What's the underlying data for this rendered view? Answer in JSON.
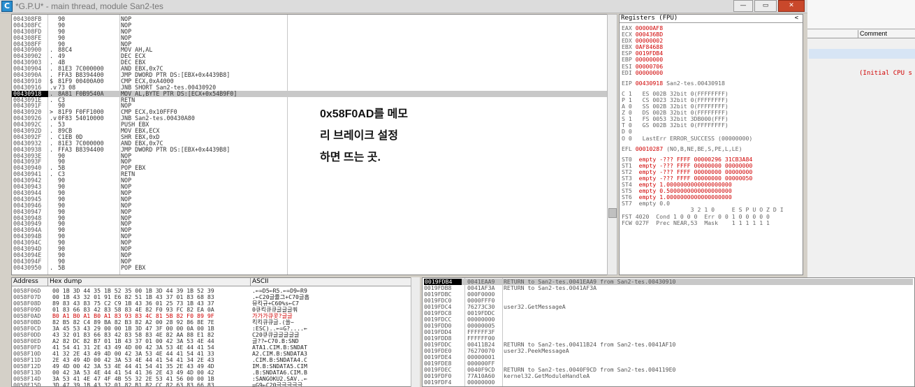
{
  "window": {
    "title": "*G.P.U* - main thread, module San2-tes",
    "icon_letter": "C",
    "min_label": "—",
    "max_label": "▭",
    "close_label": "✕"
  },
  "background_window": {
    "comment_header": "Comment",
    "initial_text": "(Initial CPU s"
  },
  "cpu": {
    "rows": [
      {
        "addr": "004308FB",
        "mark": "",
        "hex": "90",
        "dis": "NOP"
      },
      {
        "addr": "004308FC",
        "mark": "",
        "hex": "90",
        "dis": "NOP"
      },
      {
        "addr": "004308FD",
        "mark": "",
        "hex": "90",
        "dis": "NOP"
      },
      {
        "addr": "004308FE",
        "mark": "",
        "hex": "90",
        "dis": "NOP"
      },
      {
        "addr": "004308FF",
        "mark": "",
        "hex": "90",
        "dis": "NOP"
      },
      {
        "addr": "00430900",
        "mark": ".",
        "hex": "88C4",
        "dis": "MOV AH,AL"
      },
      {
        "addr": "00430902",
        "mark": ".",
        "hex": "49",
        "dis": "DEC ECX"
      },
      {
        "addr": "00430903",
        "mark": ".",
        "hex": "4B",
        "dis": "DEC EBX"
      },
      {
        "addr": "00430904",
        "mark": ".",
        "hex": "81E3 7C000000",
        "dis": "AND EBX,0x7C"
      },
      {
        "addr": "0043090A",
        "mark": ".",
        "hex": "FFA3 B8394400",
        "dis": "JMP DWORD PTR DS:[EBX+0x4439B8]"
      },
      {
        "addr": "00430910",
        "mark": "$",
        "hex": "81F9 00400A00",
        "dis": "CMP ECX,0xA4000"
      },
      {
        "addr": "00430916",
        "mark": ".v",
        "hex": "73 08",
        "dis": "JNB SHORT San2-tes.00430920"
      },
      {
        "addr": "00430918",
        "mark": ".",
        "hex": "8A81 F0B9540A",
        "dis": "MOV AL,BYTE PTR DS:[ECX+0x54B9F0]"
      },
      {
        "addr": "0043091E",
        "mark": ".",
        "hex": "C3",
        "dis": "RETN"
      },
      {
        "addr": "0043091F",
        "mark": "",
        "hex": "90",
        "dis": "NOP"
      },
      {
        "addr": "00430920",
        "mark": ">",
        "hex": "81F9 F0FF1000",
        "dis": "CMP ECX,0x10FFF0"
      },
      {
        "addr": "00430926",
        "mark": ".v",
        "hex": "0F83 54010000",
        "dis": "JNB San2-tes.00430A80"
      },
      {
        "addr": "0043092C",
        "mark": ".",
        "hex": "53",
        "dis": "PUSH EBX"
      },
      {
        "addr": "0043092D",
        "mark": ".",
        "hex": "89CB",
        "dis": "MOV EBX,ECX"
      },
      {
        "addr": "0043092F",
        "mark": ".",
        "hex": "C1EB 0D",
        "dis": "SHR EBX,0xD"
      },
      {
        "addr": "00430932",
        "mark": ".",
        "hex": "81E3 7C000000",
        "dis": "AND EBX,0x7C"
      },
      {
        "addr": "00430938",
        "mark": ".",
        "hex": "FFA3 B8394400",
        "dis": "JMP DWORD PTR DS:[EBX+0x4439B8]"
      },
      {
        "addr": "0043093E",
        "mark": "",
        "hex": "90",
        "dis": "NOP"
      },
      {
        "addr": "0043093F",
        "mark": "",
        "hex": "90",
        "dis": "NOP"
      },
      {
        "addr": "00430940",
        "mark": ".",
        "hex": "5B",
        "dis": "POP EBX"
      },
      {
        "addr": "00430941",
        "mark": ".",
        "hex": "C3",
        "dis": "RETN"
      },
      {
        "addr": "00430942",
        "mark": "",
        "hex": "90",
        "dis": "NOP"
      },
      {
        "addr": "00430943",
        "mark": "",
        "hex": "90",
        "dis": "NOP"
      },
      {
        "addr": "00430944",
        "mark": "",
        "hex": "90",
        "dis": "NOP"
      },
      {
        "addr": "00430945",
        "mark": "",
        "hex": "90",
        "dis": "NOP"
      },
      {
        "addr": "00430946",
        "mark": "",
        "hex": "90",
        "dis": "NOP"
      },
      {
        "addr": "00430947",
        "mark": "",
        "hex": "90",
        "dis": "NOP"
      },
      {
        "addr": "00430948",
        "mark": "",
        "hex": "90",
        "dis": "NOP"
      },
      {
        "addr": "00430949",
        "mark": "",
        "hex": "90",
        "dis": "NOP"
      },
      {
        "addr": "0043094A",
        "mark": "",
        "hex": "90",
        "dis": "NOP"
      },
      {
        "addr": "0043094B",
        "mark": "",
        "hex": "90",
        "dis": "NOP"
      },
      {
        "addr": "0043094C",
        "mark": "",
        "hex": "90",
        "dis": "NOP"
      },
      {
        "addr": "0043094D",
        "mark": "",
        "hex": "90",
        "dis": "NOP"
      },
      {
        "addr": "0043094E",
        "mark": "",
        "hex": "90",
        "dis": "NOP"
      },
      {
        "addr": "0043094F",
        "mark": "",
        "hex": "90",
        "dis": "NOP"
      },
      {
        "addr": "00430950",
        "mark": ".",
        "hex": "5B",
        "dis": "POP EBX"
      }
    ],
    "annotation": [
      "0x58F0AD를 메모",
      "리 브레이크 설정",
      "하면 뜨는 곳."
    ]
  },
  "registers": {
    "header": "Registers (FPU)",
    "chevron": "<",
    "lines": [
      {
        "label": "EAX",
        "value": "00000AF8",
        "extra": "",
        "red": true
      },
      {
        "label": "ECX",
        "value": "000436BD",
        "extra": "",
        "red": true
      },
      {
        "label": "EDX",
        "value": "00000002",
        "extra": "",
        "red": true
      },
      {
        "label": "EBX",
        "value": "0AF84688",
        "extra": "",
        "red": true
      },
      {
        "label": "ESP",
        "value": "0019FDB4",
        "extra": "",
        "red": true
      },
      {
        "label": "EBP",
        "value": "00000000",
        "extra": "",
        "red": true
      },
      {
        "label": "ESI",
        "value": "00000706",
        "extra": "",
        "red": true
      },
      {
        "label": "EDI",
        "value": "00000000",
        "extra": "",
        "red": true
      },
      {
        "gap": true
      },
      {
        "label": "EIP",
        "value": "00430918",
        "extra": " San2-tes.00430918",
        "red": true
      },
      {
        "gap": true
      },
      {
        "label": "C 1",
        "value": "",
        "extra": "  ES 002B 32bit 0(FFFFFFFF)",
        "red": false
      },
      {
        "label": "P 1",
        "value": "",
        "extra": "  CS 0023 32bit 0(FFFFFFFF)",
        "red": false
      },
      {
        "label": "A 0",
        "value": "",
        "extra": "  SS 002B 32bit 0(FFFFFFFF)",
        "red": false
      },
      {
        "label": "Z 0",
        "value": "",
        "extra": "  DS 002B 32bit 0(FFFFFFFF)",
        "red": false
      },
      {
        "label": "S 1",
        "value": "",
        "extra": "  FS 0053 32bit 3DB000(FFF)",
        "red": false
      },
      {
        "label": "T 0",
        "value": "",
        "extra": "  GS 002B 32bit 0(FFFFFFFF)",
        "red": false
      },
      {
        "label": "D 0",
        "value": "",
        "extra": "",
        "red": false
      },
      {
        "label": "O 0",
        "value": "",
        "extra": "  LastErr ERROR_SUCCESS (00000000)",
        "red": false
      },
      {
        "gap": true
      },
      {
        "label": "EFL",
        "value": "00010287",
        "extra": " (NO,B,NE,BE,S,PE,L,LE)",
        "red": true
      },
      {
        "gap": true
      },
      {
        "label": "ST0",
        "value": "",
        "extra": " empty -??? FFFF 00000296 31CB3A84",
        "red": true
      },
      {
        "label": "ST1",
        "value": "",
        "extra": " empty -??? FFFF 00000000 00000000",
        "red": true
      },
      {
        "label": "ST2",
        "value": "",
        "extra": " empty -??? FFFF 00000000 00000000",
        "red": true
      },
      {
        "label": "ST3",
        "value": "",
        "extra": " empty -??? FFFF 00000000 00000050",
        "red": true
      },
      {
        "label": "ST4",
        "value": "",
        "extra": " empty 1.0000000000000000000",
        "red": true
      },
      {
        "label": "ST5",
        "value": "",
        "extra": " empty 0.5000000000000000000",
        "red": true
      },
      {
        "label": "ST6",
        "value": "",
        "extra": " empty 1.0000000000000000000",
        "red": true
      },
      {
        "label": "ST7",
        "value": "",
        "extra": " empty 0.0",
        "red": false
      },
      {
        "label": "   ",
        "value": "",
        "extra": "                3 2 1 0     E S P U O Z D I",
        "red": false
      },
      {
        "label": "FST",
        "value": "4020",
        "extra": "  Cond 1 0 0 0  Err 0 0 1 0 0 0 0 0",
        "red": false
      },
      {
        "label": "FCW",
        "value": "027F",
        "extra": "  Prec NEAR,53  Mask    1 1 1 1 1 1",
        "red": false
      }
    ]
  },
  "dump": {
    "col_address": "Address",
    "col_hex": "Hex dump",
    "col_ascii": "ASCII",
    "rows": [
      {
        "addr": "0058F06D",
        "hex": "00 1B 3D 44 35 1B 52 35 00 1B 3D 44 39 1B 52 39",
        "ascii": ".←=D5←R5.←=D9←R9",
        "hl": false
      },
      {
        "addr": "0058F07D",
        "hex": "00 1B 43 32 01 91 E6 82 51 1B 43 37 01 83 68 83",
        "ascii": ".←C20글률그+C70글홉",
        "hl": false
      },
      {
        "addr": "0058F08D",
        "hex": "89 83 43 83 75 C2 C9 1B 43 36 01 25 73 1B 43 37",
        "ascii": "뮤킥규+C60%s←C7",
        "hl": false
      },
      {
        "addr": "0058F09D",
        "hex": "01 83 66 83 42 83 58 83 4E 82 F0 93 FC 82 EA 0A",
        "ascii": "0큐킥큐큐글글글쿼",
        "hl": false
      },
      {
        "addr": "0058F0AD",
        "hex": "B0 A1 B0 A1 B0 A1 83 93 83 4C 81 5B 82 F0 89 9F",
        "ascii": "가가가큐콧?글글",
        "hl": true
      },
      {
        "addr": "0058F0BD",
        "hex": "82 B5 82 C4 89 BA 82 B3 82 A2 00 28 92 86 8E 7E",
        "ascii": "킥킥큐큐글.(쏠~",
        "hl": false
      },
      {
        "addr": "0058F0CD",
        "hex": "3A 45 53 43 29 00 00 1B 3D 47 3F 00 00 0A 00 1B",
        "ascii": ":ESC)..←=G?....←",
        "hl": false
      },
      {
        "addr": "0058F0DD",
        "hex": "43 32 01 83 66 83 42 83 58 83 4E 82 AA 88 E1 82",
        "ascii": "C20큐큐글글글글글",
        "hl": false
      },
      {
        "addr": "0058F0ED",
        "hex": "A2 82 DC 82 B7 01 1B 43 37 01 00 42 3A 53 4E 44",
        "ascii": "글??←C70.B:SND",
        "hl": false
      },
      {
        "addr": "0058F0FD",
        "hex": "41 54 41 31 2E 43 49 4D 00 42 3A 53 4E 44 41 54",
        "ascii": "ATA1.CIM.B:SNDAT",
        "hl": false
      },
      {
        "addr": "0058F10D",
        "hex": "41 32 2E 43 49 4D 00 42 3A 53 4E 44 41 54 41 33",
        "ascii": "A2.CIM.B:SNDATA3",
        "hl": false
      },
      {
        "addr": "0058F11D",
        "hex": "2E 43 49 4D 00 42 3A 53 4E 44 41 54 41 34 2E 43",
        "ascii": ".CIM.B:SNDATA4.C",
        "hl": false
      },
      {
        "addr": "0058F12D",
        "hex": "49 4D 00 42 3A 53 4E 44 41 54 41 35 2E 43 49 4D",
        "ascii": "IM.B:SNDATA5.CIM",
        "hl": false
      },
      {
        "addr": "0058F13D",
        "hex": "00 42 3A 53 4E 44 41 54 41 36 2E 43 49 4D 00 42",
        "ascii": ".B:SNDATA6.CIM.B",
        "hl": false
      },
      {
        "addr": "0058F14D",
        "hex": "3A 53 41 4E 47 4F 4B 55 32 2E 53 41 56 00 00 1B",
        "ascii": ":SANGOKU2.SAV..←",
        "hl": false
      },
      {
        "addr": "0058F15D",
        "hex": "3D 47 39 1B 43 32 01 82 B1 82 CC 82 63 83 66 83",
        "ascii": "=G9←C20글글글글글",
        "hl": false
      }
    ]
  },
  "stack": {
    "rows": [
      {
        "addr": "0019FDB4",
        "val": "0041EAA9",
        "com": "RETURN to San2-tes.0041EAA9 from San2-tes.00430910",
        "sel": true
      },
      {
        "addr": "0019FDB8",
        "val": "0041AF3A",
        "com": "RETURN to San2-tes.0041AF3A",
        "sel": false
      },
      {
        "addr": "0019FDBC",
        "val": "000F0000",
        "com": "",
        "sel": false
      },
      {
        "addr": "0019FDC0",
        "val": "0000FFF0",
        "com": "",
        "sel": false
      },
      {
        "addr": "0019FDC4",
        "val": "76273C30",
        "com": "user32.GetMessageA",
        "sel": false
      },
      {
        "addr": "0019FDC8",
        "val": "0019FDDC",
        "com": "",
        "sel": false
      },
      {
        "addr": "0019FDCC",
        "val": "00000000",
        "com": "",
        "sel": false
      },
      {
        "addr": "0019FDD0",
        "val": "00000005",
        "com": "",
        "sel": false
      },
      {
        "addr": "0019FDD4",
        "val": "FFFFFF3F",
        "com": "",
        "sel": false
      },
      {
        "addr": "0019FDD8",
        "val": "FFFFFF00",
        "com": "",
        "sel": false
      },
      {
        "addr": "0019FDDC",
        "val": "00411B24",
        "com": "RETURN to San2-tes.00411B24 from San2-tes.0041AF10",
        "sel": false
      },
      {
        "addr": "0019FDE0",
        "val": "76270070",
        "com": "user32.PeekMessageA",
        "sel": false
      },
      {
        "addr": "0019FDE4",
        "val": "00000001",
        "com": "",
        "sel": false
      },
      {
        "addr": "0019FDE8",
        "val": "000000FF",
        "com": "",
        "sel": false
      },
      {
        "addr": "0019FDEC",
        "val": "0040F9CD",
        "com": "RETURN to San2-tes.0040F9CD from San2-tes.004119E0",
        "sel": false
      },
      {
        "addr": "0019FDF0",
        "val": "77A10A60",
        "com": "kernel32.GetModuleHandleA",
        "sel": false
      },
      {
        "addr": "0019FDF4",
        "val": "00000000",
        "com": "",
        "sel": false
      }
    ]
  }
}
